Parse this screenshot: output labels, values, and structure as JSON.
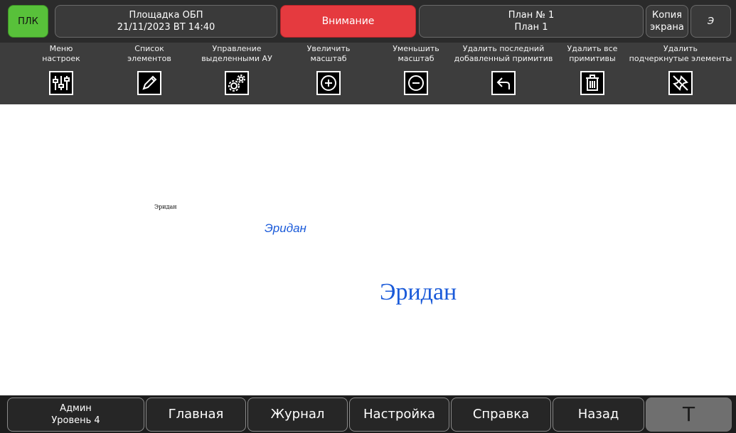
{
  "top": {
    "plk": "ПЛК",
    "site_name": "Площадка ОБП",
    "datetime": "21/11/2023 ВТ 14:40",
    "warning": "Внимание",
    "plan_number": "План № 1",
    "plan_name": "План 1",
    "copy_line1": "Копия",
    "copy_line2": "экрана",
    "user_initial": "Э"
  },
  "toolbar": [
    {
      "l1": "Меню",
      "l2": "настроек",
      "icon": "sliders-icon"
    },
    {
      "l1": "Список",
      "l2": "элементов",
      "icon": "pencil-icon"
    },
    {
      "l1": "Управление",
      "l2": "выделенными АУ",
      "icon": "gears-icon"
    },
    {
      "l1": "Увеличить",
      "l2": "масштаб",
      "icon": "zoom-in-icon"
    },
    {
      "l1": "Уменьшить",
      "l2": "масштаб",
      "icon": "zoom-out-icon"
    },
    {
      "l1": "Удалить последний",
      "l2": "добавленный примитив",
      "icon": "undo-arrow-icon"
    },
    {
      "l1": "Удалить все",
      "l2": "примитивы",
      "icon": "trash-icon"
    },
    {
      "l1": "Удалить",
      "l2": "подчеркнутые элементы",
      "icon": "crossed-pin-icon"
    }
  ],
  "canvas": {
    "text_small": "Эридан",
    "text_medium": "Эридан",
    "text_large": "Эридан"
  },
  "bottom": {
    "user_role": "Админ",
    "user_level": "Уровень 4",
    "home": "Главная",
    "journal": "Журнал",
    "settings": "Настройка",
    "help": "Справка",
    "back": "Назад",
    "t": "Т"
  },
  "colors": {
    "plk_green": "#58c13a",
    "warning_red": "#e53a3f",
    "canvas_text_blue": "#1a5ad9"
  }
}
